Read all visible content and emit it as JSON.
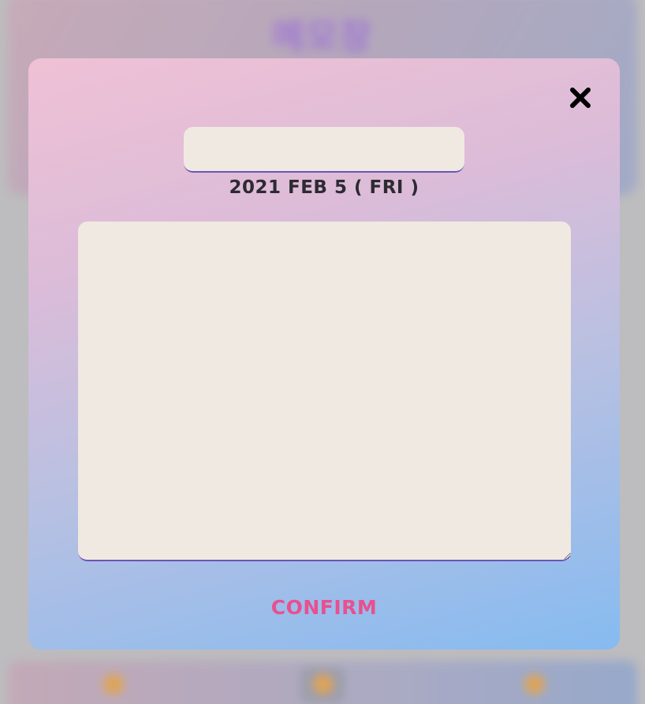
{
  "app": {
    "title": "메모장"
  },
  "modal": {
    "title_input": {
      "value": "",
      "placeholder": ""
    },
    "date": "2021 FEB 5 ( FRI )",
    "content": {
      "value": "",
      "placeholder": ""
    },
    "confirm_label": "CONFIRM",
    "close_icon": "close-icon"
  },
  "colors": {
    "accent": "#e8508f",
    "underline": "#6a55b8",
    "field_bg": "#f0e9e1",
    "gradient_top": "#efc1d5",
    "gradient_bottom": "#86bbf0"
  },
  "bottom_nav": {
    "icons": [
      "nav-icon-left",
      "nav-icon-center",
      "nav-icon-right"
    ]
  }
}
